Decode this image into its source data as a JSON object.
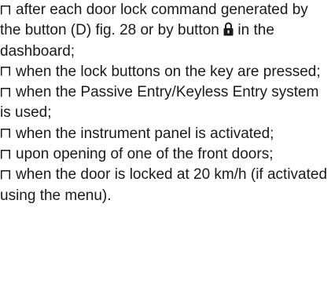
{
  "items": [
    {
      "text": "after each door lock command generated by the button (D) fig. 28 or by button",
      "icon": "lock-icon",
      "suffix": " in the dashboard;"
    },
    {
      "text": "when the lock buttons on the key are pressed;"
    },
    {
      "text": "when the Passive Entry/Keyless Entry system is used;"
    },
    {
      "text": "when the instrument panel is activated;"
    },
    {
      "text": "upon opening of one of the front doors;"
    },
    {
      "text": "when the door is locked at 20 km/h (if activated using the menu)."
    }
  ],
  "colors": {
    "text": "#1a1a1a",
    "bullet": "#1a1a1a"
  }
}
